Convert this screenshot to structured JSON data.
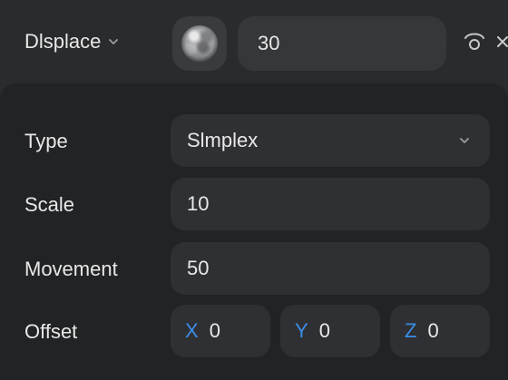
{
  "header": {
    "layer_type": "Dlsplace",
    "amount": "30"
  },
  "rows": {
    "type": {
      "label": "Type",
      "value": "Slmplex"
    },
    "scale": {
      "label": "Scale",
      "value": "10"
    },
    "movement": {
      "label": "Movement",
      "value": "50"
    },
    "offset": {
      "label": "Offset",
      "x_label": "X",
      "x_value": "0",
      "y_label": "Y",
      "y_value": "0",
      "z_label": "Z",
      "z_value": "0"
    }
  },
  "icons": {
    "layer_dropdown": "chevron-down-icon",
    "texture": "noise-texture-thumbnail",
    "visibility": "eye-icon",
    "close": "close-icon",
    "type_dropdown": "chevron-down-icon"
  },
  "colors": {
    "background": "#222325",
    "header": "#2a2b2d",
    "field": "#2f3033",
    "text": "#e8e8e8",
    "axis_accent": "#3b8eea"
  }
}
